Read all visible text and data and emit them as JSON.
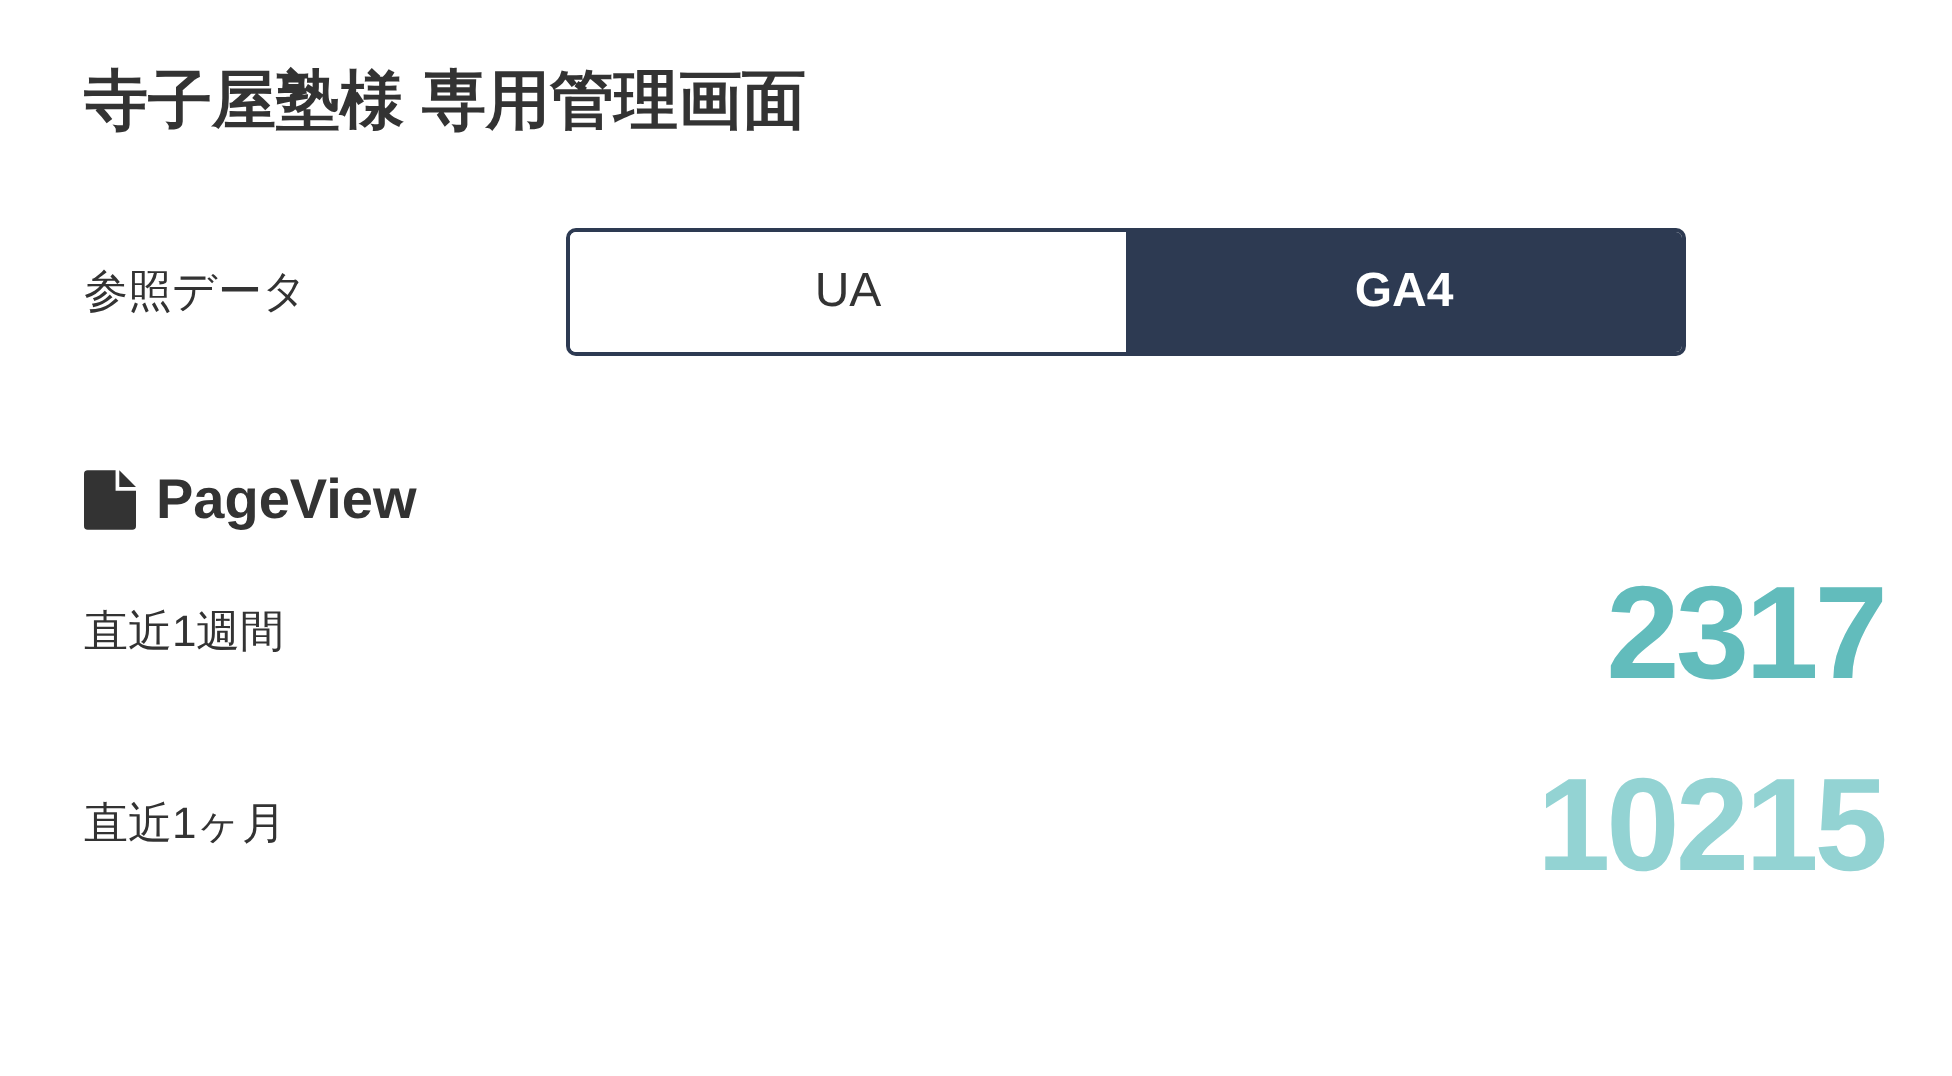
{
  "title": "寺子屋塾様 専用管理画面",
  "data_source": {
    "label": "参照データ",
    "options": [
      {
        "label": "UA",
        "selected": false
      },
      {
        "label": "GA4",
        "selected": true
      }
    ]
  },
  "section": {
    "title": "PageView"
  },
  "stats": [
    {
      "label": "直近1週間",
      "value": "2317",
      "color": "#62bcbc"
    },
    {
      "label": "直近1ヶ月",
      "value": "10215",
      "color": "#93d3d3"
    }
  ]
}
